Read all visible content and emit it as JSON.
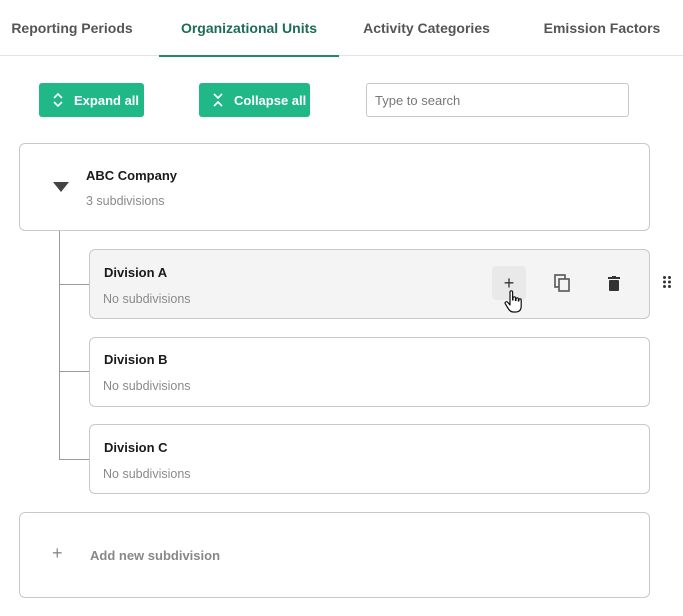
{
  "tabs": [
    {
      "label": "Reporting Periods",
      "active": false
    },
    {
      "label": "Organizational Units",
      "active": true
    },
    {
      "label": "Activity Categories",
      "active": false
    },
    {
      "label": "Emission Factors",
      "active": false
    }
  ],
  "toolbar": {
    "expand_label": "Expand all",
    "collapse_label": "Collapse all",
    "search_placeholder": "Type to search",
    "search_value": ""
  },
  "tree": {
    "root": {
      "title": "ABC Company",
      "subtitle": "3 subdivisions"
    },
    "children": [
      {
        "title": "Division A",
        "subtitle": "No subdivisions"
      },
      {
        "title": "Division B",
        "subtitle": "No subdivisions"
      },
      {
        "title": "Division C",
        "subtitle": "No subdivisions"
      }
    ]
  },
  "actions": {
    "add": "+"
  },
  "add_subdivision": {
    "plus": "+",
    "label": "Add new subdivision"
  },
  "colors": {
    "accent": "#21b887",
    "tab_active": "#1e6b56"
  },
  "icons": {
    "add": "plus-icon",
    "copy": "copy-icon",
    "delete": "trash-icon",
    "drag": "drag-handle-icon",
    "expand": "expand-icon",
    "collapse": "collapse-icon",
    "caret": "caret-down-icon"
  }
}
